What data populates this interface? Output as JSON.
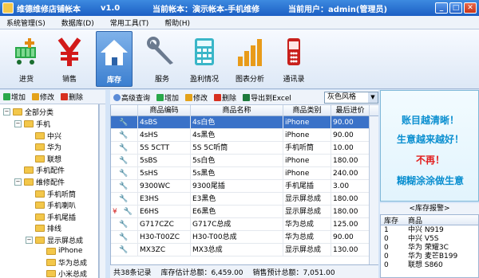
{
  "window": {
    "app_title": "维德维修店铺帐本",
    "version": "v1.0",
    "current_book": "当前帐本：演示帐本-手机维修",
    "current_user": "当前用户：admin(管理员)",
    "btn_min": "_",
    "btn_max": "□",
    "btn_close": "✕"
  },
  "menu": [
    {
      "label": "系统管理(S)"
    },
    {
      "label": "数据库(D)"
    },
    {
      "label": "常用工具(T)"
    },
    {
      "label": "帮助(H)"
    }
  ],
  "toolbar": [
    {
      "label": "进货",
      "icon": "cart-add-icon"
    },
    {
      "label": "销售",
      "icon": "yen-icon"
    },
    {
      "label": "库存",
      "icon": "house-icon",
      "active": true
    },
    {
      "label": "服务",
      "icon": "wrench-icon"
    },
    {
      "label": "盈利情况",
      "icon": "calculator-icon"
    },
    {
      "label": "图表分析",
      "icon": "bar-chart-icon"
    },
    {
      "label": "通讯录",
      "icon": "phone-icon"
    }
  ],
  "left_toolbar": {
    "add": "增加",
    "edit": "修改",
    "delete": "删除"
  },
  "tree": [
    {
      "label": "全部分类",
      "level": 0,
      "expander": "−"
    },
    {
      "label": "手机",
      "level": 1,
      "expander": "−"
    },
    {
      "label": "中兴",
      "level": 2
    },
    {
      "label": "华为",
      "level": 2
    },
    {
      "label": "联想",
      "level": 2
    },
    {
      "label": "手机配件",
      "level": 1
    },
    {
      "label": "维修配件",
      "level": 1,
      "expander": "−"
    },
    {
      "label": "手机听筒",
      "level": 2
    },
    {
      "label": "手机喇叭",
      "level": 2
    },
    {
      "label": "手机尾插",
      "level": 2
    },
    {
      "label": "排线",
      "level": 2
    },
    {
      "label": "显示屏总成",
      "level": 2,
      "expander": "−"
    },
    {
      "label": "iPhone",
      "level": 3
    },
    {
      "label": "华为总成",
      "level": 3
    },
    {
      "label": "小米总成",
      "level": 3
    }
  ],
  "main_toolbar": {
    "search": "高级查询",
    "add": "增加",
    "edit": "修改",
    "delete": "删除",
    "export": "导出到Excel",
    "style": "灰色风格"
  },
  "grid": {
    "columns": [
      "商品编码",
      "商品名称",
      "商品类别",
      "最后进价"
    ],
    "rows": [
      {
        "code": "4sBS",
        "name": "4s白色",
        "category": "iPhone",
        "price": "90.00",
        "selected": true
      },
      {
        "code": "4sHS",
        "name": "4s黑色",
        "category": "iPhone",
        "price": "90.00"
      },
      {
        "code": "5S 5CTT",
        "name": "5S 5C听筒",
        "category": "手机听筒",
        "price": "10.00"
      },
      {
        "code": "5sBS",
        "name": "5s白色",
        "category": "iPhone",
        "price": "180.00"
      },
      {
        "code": "5sHS",
        "name": "5s黑色",
        "category": "iPhone",
        "price": "240.00"
      },
      {
        "code": "9300WC",
        "name": "9300尾插",
        "category": "手机尾插",
        "price": "3.00"
      },
      {
        "code": "E3HS",
        "name": "E3黑色",
        "category": "显示屏总成",
        "price": "180.00"
      },
      {
        "code": "E6HS",
        "name": "E6黑色",
        "category": "显示屏总成",
        "price": "180.00",
        "alert": true
      },
      {
        "code": "G717CZC",
        "name": "G717C总成",
        "category": "华为总成",
        "price": "125.00"
      },
      {
        "code": "H30-T00ZC",
        "name": "H30-T00总成",
        "category": "华为总成",
        "price": "90.00"
      },
      {
        "code": "MX3ZC",
        "name": "MX3总成",
        "category": "显示屏总成",
        "price": "130.00"
      }
    ]
  },
  "status": {
    "count": "共38条记录",
    "stock_total": "库存估计总额：6,459.00",
    "sales_total": "销售预计总额：7,051.00"
  },
  "ad": {
    "line1": "账目越清晰！",
    "line2": "生意越来越好！",
    "line3": "不再！",
    "line4": "糊糊涂涂做生意"
  },
  "stock_alert": {
    "title": "<库存报警>",
    "columns": [
      "库存",
      "商品"
    ],
    "rows": [
      {
        "qty": "1",
        "name": "中兴 N919"
      },
      {
        "qty": "0",
        "name": "中兴 V5S"
      },
      {
        "qty": "0",
        "name": "华为 荣耀3C"
      },
      {
        "qty": "0",
        "name": "华为 麦芒B199"
      },
      {
        "qty": "0",
        "name": "联想 S860"
      }
    ]
  },
  "colors": {
    "titlebar": "#2a6fd6",
    "selected_row": "#3a72c8",
    "ad_blue": "#0b8fd0",
    "ad_red": "#e21c1c"
  }
}
